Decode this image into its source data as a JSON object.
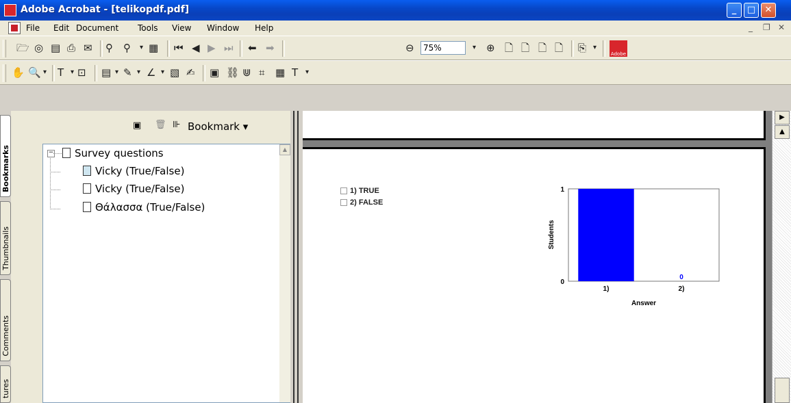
{
  "window": {
    "title": "Adobe Acrobat - [telikopdf.pdf]"
  },
  "menu": [
    "File",
    "Edit",
    "Document",
    "Tools",
    "View",
    "Window",
    "Help"
  ],
  "zoom": {
    "value": "75%"
  },
  "tabs": [
    "Bookmarks",
    "Thumbnails",
    "Comments",
    "tures"
  ],
  "bookmarks": {
    "menu_label": "Bookmark",
    "items": [
      {
        "label": "Survey questions",
        "level": 0
      },
      {
        "label": "Vicky (True/False)",
        "level": 1
      },
      {
        "label": "Vicky (True/False)",
        "level": 1
      },
      {
        "label": "Θάλασσα (True/False)",
        "level": 1
      }
    ]
  },
  "document": {
    "options": [
      "1) TRUE",
      "2) FALSE"
    ]
  },
  "chart_data": {
    "type": "bar",
    "categories": [
      "1)",
      "2)"
    ],
    "values": [
      1,
      0
    ],
    "xlabel": "Answer",
    "ylabel": "Students",
    "ylim": [
      0,
      1
    ],
    "data_labels": [
      "",
      "0"
    ],
    "color": "#0000ff"
  },
  "icons": {
    "adobe_badge": "Adobe"
  }
}
